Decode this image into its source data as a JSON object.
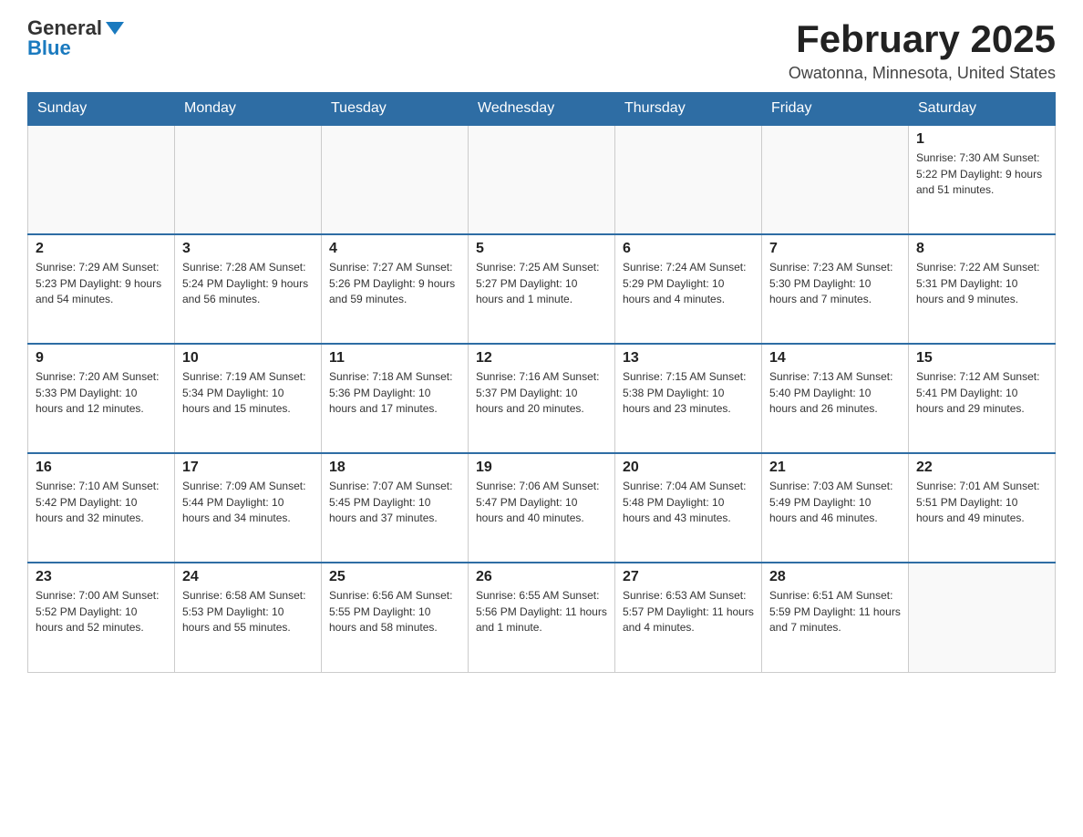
{
  "logo": {
    "general": "General",
    "blue": "Blue"
  },
  "title": "February 2025",
  "location": "Owatonna, Minnesota, United States",
  "days_of_week": [
    "Sunday",
    "Monday",
    "Tuesday",
    "Wednesday",
    "Thursday",
    "Friday",
    "Saturday"
  ],
  "weeks": [
    [
      {
        "day": "",
        "info": ""
      },
      {
        "day": "",
        "info": ""
      },
      {
        "day": "",
        "info": ""
      },
      {
        "day": "",
        "info": ""
      },
      {
        "day": "",
        "info": ""
      },
      {
        "day": "",
        "info": ""
      },
      {
        "day": "1",
        "info": "Sunrise: 7:30 AM\nSunset: 5:22 PM\nDaylight: 9 hours and 51 minutes."
      }
    ],
    [
      {
        "day": "2",
        "info": "Sunrise: 7:29 AM\nSunset: 5:23 PM\nDaylight: 9 hours and 54 minutes."
      },
      {
        "day": "3",
        "info": "Sunrise: 7:28 AM\nSunset: 5:24 PM\nDaylight: 9 hours and 56 minutes."
      },
      {
        "day": "4",
        "info": "Sunrise: 7:27 AM\nSunset: 5:26 PM\nDaylight: 9 hours and 59 minutes."
      },
      {
        "day": "5",
        "info": "Sunrise: 7:25 AM\nSunset: 5:27 PM\nDaylight: 10 hours and 1 minute."
      },
      {
        "day": "6",
        "info": "Sunrise: 7:24 AM\nSunset: 5:29 PM\nDaylight: 10 hours and 4 minutes."
      },
      {
        "day": "7",
        "info": "Sunrise: 7:23 AM\nSunset: 5:30 PM\nDaylight: 10 hours and 7 minutes."
      },
      {
        "day": "8",
        "info": "Sunrise: 7:22 AM\nSunset: 5:31 PM\nDaylight: 10 hours and 9 minutes."
      }
    ],
    [
      {
        "day": "9",
        "info": "Sunrise: 7:20 AM\nSunset: 5:33 PM\nDaylight: 10 hours and 12 minutes."
      },
      {
        "day": "10",
        "info": "Sunrise: 7:19 AM\nSunset: 5:34 PM\nDaylight: 10 hours and 15 minutes."
      },
      {
        "day": "11",
        "info": "Sunrise: 7:18 AM\nSunset: 5:36 PM\nDaylight: 10 hours and 17 minutes."
      },
      {
        "day": "12",
        "info": "Sunrise: 7:16 AM\nSunset: 5:37 PM\nDaylight: 10 hours and 20 minutes."
      },
      {
        "day": "13",
        "info": "Sunrise: 7:15 AM\nSunset: 5:38 PM\nDaylight: 10 hours and 23 minutes."
      },
      {
        "day": "14",
        "info": "Sunrise: 7:13 AM\nSunset: 5:40 PM\nDaylight: 10 hours and 26 minutes."
      },
      {
        "day": "15",
        "info": "Sunrise: 7:12 AM\nSunset: 5:41 PM\nDaylight: 10 hours and 29 minutes."
      }
    ],
    [
      {
        "day": "16",
        "info": "Sunrise: 7:10 AM\nSunset: 5:42 PM\nDaylight: 10 hours and 32 minutes."
      },
      {
        "day": "17",
        "info": "Sunrise: 7:09 AM\nSunset: 5:44 PM\nDaylight: 10 hours and 34 minutes."
      },
      {
        "day": "18",
        "info": "Sunrise: 7:07 AM\nSunset: 5:45 PM\nDaylight: 10 hours and 37 minutes."
      },
      {
        "day": "19",
        "info": "Sunrise: 7:06 AM\nSunset: 5:47 PM\nDaylight: 10 hours and 40 minutes."
      },
      {
        "day": "20",
        "info": "Sunrise: 7:04 AM\nSunset: 5:48 PM\nDaylight: 10 hours and 43 minutes."
      },
      {
        "day": "21",
        "info": "Sunrise: 7:03 AM\nSunset: 5:49 PM\nDaylight: 10 hours and 46 minutes."
      },
      {
        "day": "22",
        "info": "Sunrise: 7:01 AM\nSunset: 5:51 PM\nDaylight: 10 hours and 49 minutes."
      }
    ],
    [
      {
        "day": "23",
        "info": "Sunrise: 7:00 AM\nSunset: 5:52 PM\nDaylight: 10 hours and 52 minutes."
      },
      {
        "day": "24",
        "info": "Sunrise: 6:58 AM\nSunset: 5:53 PM\nDaylight: 10 hours and 55 minutes."
      },
      {
        "day": "25",
        "info": "Sunrise: 6:56 AM\nSunset: 5:55 PM\nDaylight: 10 hours and 58 minutes."
      },
      {
        "day": "26",
        "info": "Sunrise: 6:55 AM\nSunset: 5:56 PM\nDaylight: 11 hours and 1 minute."
      },
      {
        "day": "27",
        "info": "Sunrise: 6:53 AM\nSunset: 5:57 PM\nDaylight: 11 hours and 4 minutes."
      },
      {
        "day": "28",
        "info": "Sunrise: 6:51 AM\nSunset: 5:59 PM\nDaylight: 11 hours and 7 minutes."
      },
      {
        "day": "",
        "info": ""
      }
    ]
  ]
}
